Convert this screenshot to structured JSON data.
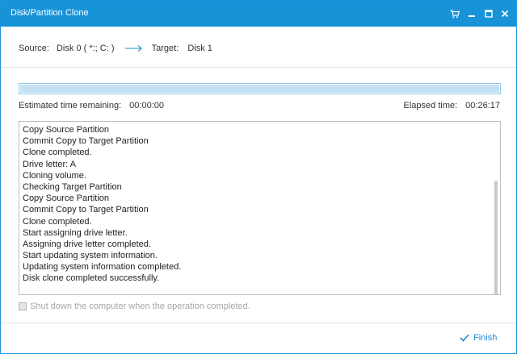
{
  "window": {
    "title": "Disk/Partition Clone",
    "accent_color": "#1993d8",
    "titlebar_icons": [
      "cart-icon",
      "minimize-icon",
      "maximize-icon",
      "close-icon"
    ]
  },
  "source_target": {
    "source_label": "Source:",
    "source_value": "Disk 0 ( *:; C: )",
    "target_label": "Target:",
    "target_value": "Disk 1"
  },
  "progress": {
    "fraction": 1.0
  },
  "times": {
    "estimated_label": "Estimated time remaining:",
    "estimated_value": "00:00:00",
    "elapsed_label": "Elapsed time:",
    "elapsed_value": "00:26:17"
  },
  "log": [
    "Copy Source Partition",
    "Commit Copy to Target Partition",
    "Clone completed.",
    "Drive letter: A",
    "Cloning volume.",
    "Checking Target Partition",
    "Copy Source Partition",
    "Commit Copy to Target Partition",
    "Clone completed.",
    "Start assigning drive letter.",
    "Assigning drive letter completed.",
    "Start updating system information.",
    "Updating system information completed.",
    "Disk clone completed successfully."
  ],
  "shutdown_option": {
    "label": "Shut down the computer when the operation completed.",
    "checked": false,
    "enabled": false
  },
  "footer": {
    "finish_label": "Finish"
  }
}
